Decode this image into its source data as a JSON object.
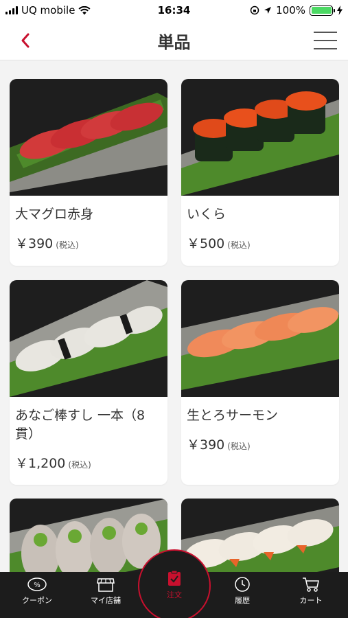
{
  "status": {
    "carrier": "UQ mobile",
    "time": "16:34",
    "battery": "100%"
  },
  "header": {
    "title": "単品"
  },
  "items": [
    {
      "name": "大マグロ赤身",
      "price": "￥390",
      "tax": "(税込)"
    },
    {
      "name": "いくら",
      "price": "￥500",
      "tax": "(税込)"
    },
    {
      "name": "あなご棒すし 一本（8貫）",
      "price": "￥1,200",
      "tax": "(税込)"
    },
    {
      "name": "生とろサーモン",
      "price": "￥390",
      "tax": "(税込)"
    }
  ],
  "tabbar": {
    "coupon": "クーポン",
    "my_store": "マイ店舗",
    "order": "注文",
    "history": "履歴",
    "cart": "カート"
  },
  "colors": {
    "accent": "#c8102e",
    "tabbar_bg": "#1c1c1c",
    "page_bg": "#f3f3f3"
  }
}
